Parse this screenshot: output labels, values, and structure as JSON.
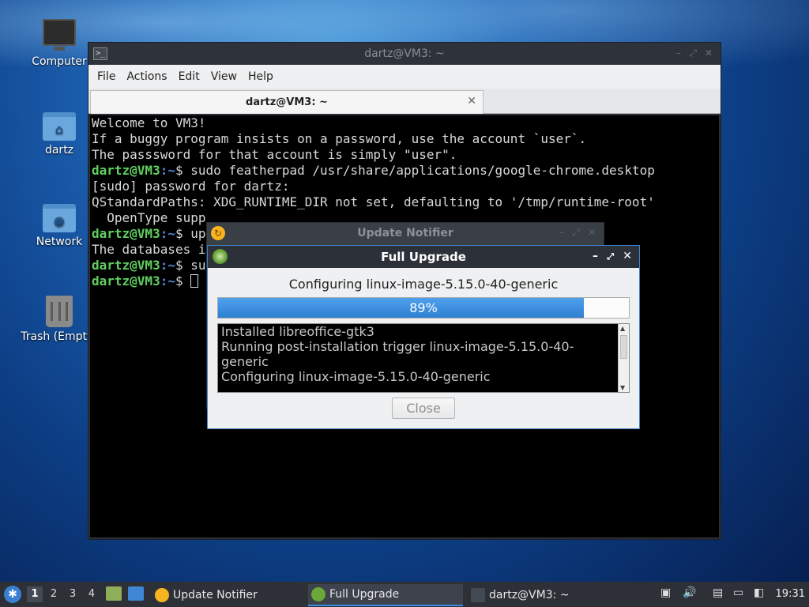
{
  "desktop": {
    "icons": [
      {
        "label": "Computer"
      },
      {
        "label": "dartz"
      },
      {
        "label": "Network"
      },
      {
        "label": "Trash (Empty)"
      }
    ]
  },
  "terminal": {
    "window_title": "dartz@VM3: ~",
    "menu": [
      "File",
      "Actions",
      "Edit",
      "View",
      "Help"
    ],
    "tab_label": "dartz@VM3: ~",
    "prompt_user": "dartz@VM3",
    "prompt_path": ":~",
    "prompt_symbol": "$",
    "lines": [
      "Welcome to VM3!",
      "If a buggy program insists on a password, use the account `user`.",
      "The passsword for that account is simply \"user\".",
      "",
      " sudo featherpad /usr/share/applications/google-chrome.desktop",
      "[sudo] password for dartz:",
      "QStandardPaths: XDG_RUNTIME_DIR not set, defaulting to '/tmp/runtime-root'",
      "  OpenType supp",
      " up",
      "The databases i",
      " su",
      " "
    ]
  },
  "update_notifier": {
    "title": "Update Notifier"
  },
  "full_upgrade": {
    "title": "Full Upgrade",
    "status": "Configuring linux-image-5.15.0-40-generic",
    "progress_percent": 89,
    "progress_label": "89%",
    "log": [
      "Installed libreoffice-gtk3",
      "Running post-installation trigger linux-image-5.15.0-40-",
      "generic",
      "Configuring linux-image-5.15.0-40-generic"
    ],
    "close_label": "Close"
  },
  "taskbar": {
    "workspaces": [
      "1",
      "2",
      "3",
      "4"
    ],
    "tasks": [
      {
        "label": "Update Notifier"
      },
      {
        "label": "Full Upgrade"
      },
      {
        "label": "dartz@VM3: ~"
      }
    ],
    "clock": "19:31"
  },
  "colors": {
    "accent": "#3c8ce0",
    "prompt_user": "#60d060",
    "prompt_path": "#4f86d6"
  }
}
